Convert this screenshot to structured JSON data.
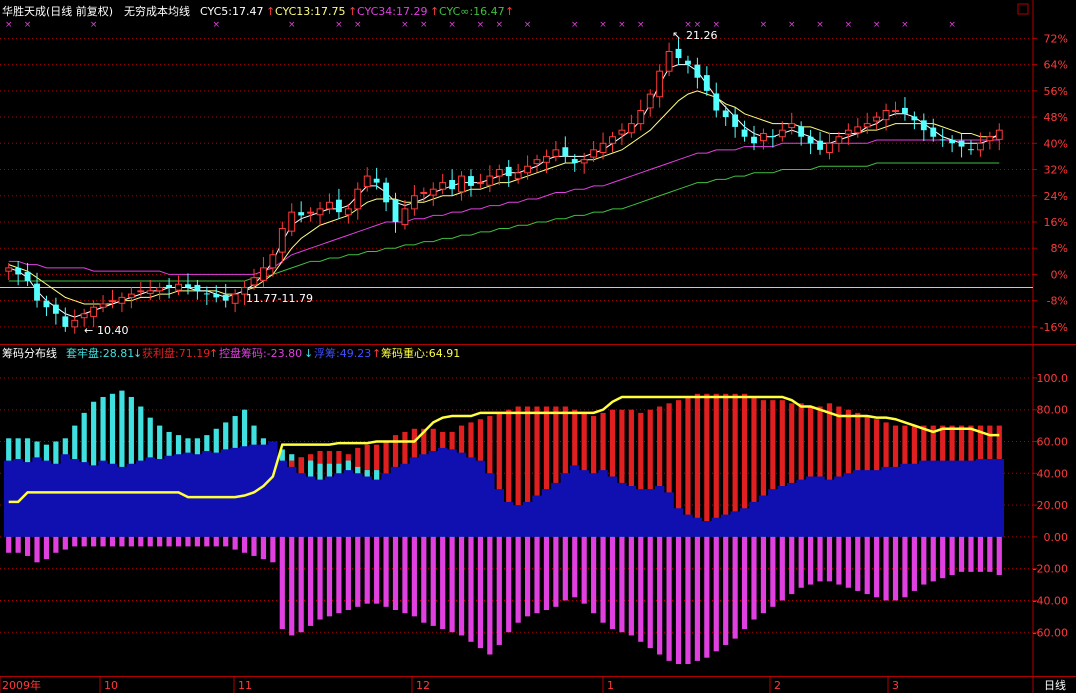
{
  "colors": {
    "frame": "#b00000",
    "up": "#ff3a3a",
    "down": "#54ffff",
    "cyc5": "#ffffff",
    "cyc13": "#ffff80",
    "cyc34": "#e040e0",
    "cycinf": "#40c040",
    "trapped": "#40e0e0",
    "profit": "#e02020",
    "control": "#e040e0",
    "float": "#1010b0",
    "center": "#ffff40",
    "axis_text": "#ff3a3a",
    "cross": "#e040e0"
  },
  "header": {
    "stock": "华胜天成(日线 前复权)",
    "indicator": "无穷成本均线",
    "cyc5": "CYC5:17.47",
    "cyc13": "CYC13:17.75",
    "cyc34": "CYC34:17.29",
    "cycinf": "CYC∞:16.47",
    "arrow": "↑"
  },
  "lower_header": {
    "name": "筹码分布线",
    "trapped": "套牢盘:28.81",
    "trapped_arrow": "↓",
    "profit": "获利盘:71.19",
    "profit_arrow": "↑",
    "control": "控盘筹码:-23.80",
    "control_arrow": "↓",
    "float": "浮筹:49.23",
    "float_arrow": "↑",
    "center": "筹码重心:64.91"
  },
  "annotations": {
    "high": "21.26",
    "low": "10.40",
    "range": "11.77-11.79"
  },
  "x_axis": {
    "labels": [
      "2009年",
      "10",
      "11",
      "12",
      "1",
      "2",
      "3"
    ],
    "period": "日线"
  },
  "chart_data": [
    {
      "type": "candlestick",
      "title": "华胜天成(日线 前复权)",
      "y_axis_labels": [
        "72%",
        "64%",
        "56%",
        "48%",
        "40%",
        "32%",
        "24%",
        "16%",
        "8%",
        "0%",
        "-8%",
        "-16%"
      ],
      "y_axis_values": [
        72,
        64,
        56,
        48,
        40,
        32,
        24,
        16,
        8,
        0,
        -8,
        -16
      ],
      "ylim": [
        -20,
        77
      ],
      "reference_line_pct": -4,
      "max_price": 21.26,
      "min_price": 10.4,
      "closes_pct": [
        2,
        0,
        -2,
        -8,
        -10,
        -12,
        -16,
        -14,
        -12,
        -10,
        -9,
        -8,
        -7,
        -6,
        -5,
        -5,
        -4,
        -4,
        -3,
        -4,
        -5,
        -6,
        -7,
        -8,
        -6,
        -4,
        -1,
        2,
        6,
        14,
        19,
        18,
        19,
        20,
        22,
        19,
        20,
        26,
        30,
        28,
        22,
        16,
        20,
        24,
        25,
        26,
        28,
        26,
        30,
        27,
        28,
        30,
        32,
        30,
        31,
        33,
        35,
        36,
        38,
        36,
        34,
        35,
        38,
        40,
        42,
        44,
        46,
        50,
        55,
        62,
        68,
        66,
        64,
        60,
        56,
        50,
        48,
        45,
        42,
        40,
        43,
        42,
        44,
        46,
        42,
        40,
        38,
        40,
        42,
        44,
        45,
        46,
        48,
        50,
        50,
        49,
        47,
        44,
        42,
        41,
        40,
        39,
        38,
        40,
        42,
        44
      ],
      "cyc5_pct": [
        2,
        1,
        -1,
        -5,
        -8,
        -10,
        -12,
        -13,
        -12,
        -11,
        -10,
        -9,
        -8,
        -7,
        -6,
        -5,
        -5,
        -4,
        -4,
        -4,
        -5,
        -5,
        -6,
        -7,
        -6,
        -5,
        -3,
        0,
        4,
        10,
        15,
        17,
        18,
        19,
        20,
        20,
        21,
        24,
        27,
        27,
        25,
        22,
        21,
        22,
        23,
        25,
        26,
        27,
        28,
        28,
        28,
        29,
        30,
        31,
        31,
        32,
        33,
        35,
        36,
        36,
        36,
        36,
        37,
        38,
        40,
        42,
        44,
        47,
        52,
        58,
        63,
        64,
        64,
        62,
        58,
        54,
        51,
        48,
        45,
        43,
        42,
        42,
        43,
        44,
        43,
        42,
        40,
        40,
        41,
        42,
        43,
        45,
        46,
        48,
        49,
        49,
        48,
        46,
        44,
        42,
        41,
        40,
        40,
        40,
        41,
        43
      ],
      "cyc13_pct": [
        3,
        2,
        1,
        -1,
        -3,
        -5,
        -7,
        -8,
        -9,
        -9,
        -9,
        -9,
        -8,
        -8,
        -7,
        -7,
        -6,
        -6,
        -5,
        -5,
        -5,
        -5,
        -5,
        -6,
        -6,
        -5,
        -4,
        -2,
        0,
        4,
        8,
        11,
        13,
        15,
        16,
        17,
        18,
        20,
        22,
        23,
        23,
        23,
        22,
        22,
        22,
        23,
        24,
        24,
        25,
        26,
        26,
        27,
        28,
        28,
        29,
        30,
        31,
        32,
        33,
        34,
        34,
        35,
        35,
        36,
        37,
        38,
        40,
        42,
        44,
        47,
        50,
        53,
        55,
        56,
        55,
        54,
        52,
        51,
        49,
        48,
        47,
        46,
        46,
        46,
        45,
        45,
        44,
        43,
        43,
        43,
        43,
        44,
        44,
        45,
        46,
        46,
        46,
        46,
        46,
        45,
        44,
        43,
        43,
        42,
        42,
        42
      ],
      "cyc34_pct": [
        4,
        4,
        3,
        3,
        2,
        2,
        2,
        2,
        2,
        1,
        1,
        1,
        1,
        1,
        1,
        1,
        1,
        0,
        0,
        0,
        0,
        0,
        0,
        0,
        0,
        0,
        0,
        1,
        2,
        4,
        6,
        7,
        8,
        9,
        10,
        11,
        12,
        13,
        14,
        15,
        16,
        16,
        16,
        17,
        17,
        18,
        18,
        19,
        19,
        20,
        20,
        21,
        21,
        22,
        22,
        23,
        23,
        24,
        25,
        25,
        26,
        26,
        27,
        27,
        28,
        29,
        30,
        31,
        32,
        33,
        34,
        35,
        36,
        37,
        37,
        38,
        38,
        38,
        39,
        39,
        39,
        39,
        40,
        40,
        40,
        40,
        40,
        40,
        40,
        40,
        40,
        40,
        41,
        41,
        41,
        41,
        41,
        41,
        41,
        41,
        41,
        41,
        41,
        41,
        41,
        41
      ],
      "cycinf_pct": [
        -2,
        -2,
        -2,
        -2,
        -2,
        -2,
        -2,
        -2,
        -2,
        -2,
        -2,
        -2,
        -2,
        -2,
        -2,
        -2,
        -2,
        -2,
        -2,
        -2,
        -2,
        -2,
        -2,
        -2,
        -2,
        -2,
        -1,
        -1,
        0,
        1,
        2,
        3,
        4,
        4,
        5,
        5,
        6,
        6,
        7,
        7,
        8,
        8,
        9,
        9,
        10,
        10,
        11,
        11,
        12,
        12,
        13,
        13,
        14,
        14,
        15,
        15,
        16,
        16,
        17,
        17,
        18,
        18,
        19,
        19,
        20,
        20,
        21,
        22,
        23,
        24,
        25,
        26,
        27,
        28,
        28,
        29,
        29,
        30,
        30,
        31,
        31,
        31,
        32,
        32,
        32,
        32,
        33,
        33,
        33,
        33,
        33,
        33,
        34,
        34,
        34,
        34,
        34,
        34,
        34,
        34,
        34,
        34,
        34,
        34,
        34,
        34
      ]
    },
    {
      "type": "bar",
      "title": "筹码分布线",
      "y_axis_labels": [
        "100.0",
        "80.00",
        "60.00",
        "40.00",
        "20.00",
        "0.00",
        "-20.00",
        "-40.00",
        "-60.00"
      ],
      "y_axis_values": [
        100,
        80,
        60,
        40,
        20,
        0,
        -20,
        -40,
        -60
      ],
      "ylim": [
        -85,
        110
      ],
      "series": [
        {
          "name": "套牢盘",
          "values": [
            62,
            62,
            62,
            60,
            58,
            60,
            62,
            70,
            78,
            85,
            88,
            90,
            92,
            88,
            82,
            75,
            70,
            66,
            64,
            62,
            62,
            64,
            68,
            72,
            76,
            80,
            70,
            62,
            58,
            55,
            52,
            50,
            48,
            46,
            46,
            46,
            48,
            44,
            42,
            42,
            40,
            36,
            34,
            32,
            32,
            32,
            34,
            34,
            30,
            28,
            26,
            24,
            22,
            20,
            18,
            18,
            18,
            18,
            18,
            18,
            20,
            22,
            24,
            22,
            20,
            20,
            20,
            22,
            20,
            18,
            16,
            14,
            12,
            10,
            10,
            10,
            10,
            10,
            10,
            12,
            14,
            14,
            14,
            16,
            16,
            18,
            18,
            16,
            18,
            20,
            22,
            24,
            26,
            28,
            30,
            30,
            30,
            30,
            30,
            30,
            30,
            30,
            30,
            30,
            30,
            30
          ]
        },
        {
          "name": "获利盘",
          "values": [
            38,
            38,
            38,
            40,
            42,
            40,
            38,
            30,
            22,
            15,
            12,
            10,
            8,
            12,
            18,
            25,
            30,
            34,
            36,
            38,
            38,
            36,
            32,
            28,
            24,
            20,
            30,
            38,
            42,
            45,
            48,
            50,
            52,
            54,
            54,
            54,
            52,
            56,
            58,
            58,
            60,
            64,
            66,
            68,
            68,
            68,
            66,
            66,
            70,
            72,
            74,
            76,
            78,
            80,
            82,
            82,
            82,
            82,
            82,
            82,
            80,
            78,
            76,
            78,
            80,
            80,
            80,
            78,
            80,
            82,
            84,
            86,
            88,
            90,
            90,
            90,
            90,
            90,
            90,
            88,
            86,
            86,
            86,
            84,
            84,
            82,
            82,
            84,
            82,
            80,
            78,
            76,
            74,
            72,
            70,
            70,
            70,
            70,
            70,
            70,
            70,
            70,
            70,
            70,
            70,
            70
          ]
        },
        {
          "name": "浮筹",
          "values": [
            48,
            49,
            47,
            50,
            48,
            46,
            52,
            49,
            47,
            45,
            48,
            46,
            44,
            46,
            48,
            50,
            49,
            51,
            52,
            53,
            52,
            54,
            53,
            55,
            56,
            57,
            58,
            58,
            60,
            48,
            44,
            40,
            38,
            36,
            38,
            40,
            42,
            40,
            38,
            36,
            40,
            44,
            46,
            50,
            52,
            54,
            56,
            55,
            53,
            50,
            48,
            40,
            30,
            22,
            20,
            22,
            26,
            30,
            34,
            40,
            45,
            42,
            40,
            42,
            38,
            34,
            32,
            30,
            30,
            32,
            28,
            18,
            14,
            12,
            10,
            12,
            14,
            16,
            18,
            22,
            26,
            30,
            32,
            34,
            36,
            38,
            38,
            36,
            38,
            40,
            42,
            42,
            42,
            44,
            44,
            46,
            46,
            48,
            48,
            48,
            48,
            48,
            48,
            49,
            49,
            49
          ]
        },
        {
          "name": "控盘筹码",
          "values": [
            -10,
            -10,
            -12,
            -16,
            -14,
            -10,
            -8,
            -6,
            -6,
            -6,
            -6,
            -6,
            -6,
            -6,
            -6,
            -6,
            -6,
            -6,
            -6,
            -6,
            -6,
            -6,
            -6,
            -6,
            -8,
            -10,
            -12,
            -14,
            -16,
            -58,
            -62,
            -60,
            -56,
            -52,
            -50,
            -48,
            -46,
            -44,
            -42,
            -42,
            -44,
            -46,
            -48,
            -50,
            -54,
            -56,
            -58,
            -60,
            -62,
            -66,
            -70,
            -74,
            -68,
            -60,
            -54,
            -50,
            -48,
            -46,
            -44,
            -40,
            -38,
            -42,
            -48,
            -54,
            -58,
            -60,
            -62,
            -66,
            -70,
            -74,
            -78,
            -80,
            -80,
            -78,
            -76,
            -72,
            -68,
            -64,
            -58,
            -52,
            -48,
            -44,
            -40,
            -36,
            -32,
            -30,
            -28,
            -28,
            -30,
            -32,
            -34,
            -36,
            -38,
            -40,
            -40,
            -38,
            -34,
            -30,
            -28,
            -26,
            -24,
            -22,
            -22,
            -22,
            -22,
            -24
          ]
        },
        {
          "name": "筹码重心",
          "values": [
            22,
            22,
            28,
            28,
            28,
            28,
            28,
            28,
            28,
            28,
            28,
            28,
            28,
            28,
            28,
            28,
            28,
            28,
            28,
            25,
            25,
            25,
            25,
            25,
            25,
            26,
            28,
            32,
            38,
            58,
            58,
            58,
            58,
            58,
            58,
            59,
            59,
            59,
            59,
            60,
            60,
            60,
            60,
            60,
            66,
            72,
            75,
            76,
            76,
            76,
            78,
            78,
            78,
            78,
            78,
            78,
            78,
            78,
            78,
            78,
            78,
            78,
            78,
            80,
            85,
            88,
            88,
            88,
            88,
            88,
            88,
            88,
            88,
            88,
            88,
            88,
            88,
            88,
            88,
            88,
            88,
            88,
            88,
            86,
            82,
            82,
            80,
            78,
            76,
            76,
            76,
            76,
            75,
            75,
            74,
            72,
            70,
            68,
            66,
            68,
            68,
            68,
            68,
            66,
            64,
            64
          ]
        }
      ]
    }
  ]
}
